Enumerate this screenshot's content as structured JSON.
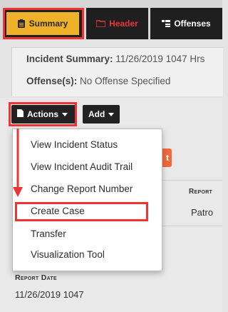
{
  "tabs": [
    {
      "label": "Summary",
      "icon": "clipboard-icon"
    },
    {
      "label": "Header",
      "icon": "folder-icon"
    },
    {
      "label": "Offenses",
      "icon": "offenses-icon"
    }
  ],
  "summary": {
    "incident_label": "Incident Summary:",
    "incident_value": "11/26/2019 1047 Hrs",
    "offense_label": "Offense(s):",
    "offense_value": "No Offense Specified"
  },
  "toolbar": {
    "actions_label": "Actions",
    "add_label": "Add",
    "orange_partial": "t"
  },
  "actions_menu": [
    "View Incident Status",
    "View Incident Audit Trail",
    "Change Report Number",
    "Create Case",
    "Transfer",
    "Visualization Tool"
  ],
  "table": {
    "col_header": "Report",
    "cell": "Patro"
  },
  "report_date": {
    "label": "Report Date",
    "value": "11/26/2019 1047"
  },
  "colors": {
    "highlight": "#e33333",
    "summary_tab": "#efb12a",
    "header_tab_text": "#e8353b",
    "orange_button": "#f06a3b"
  }
}
